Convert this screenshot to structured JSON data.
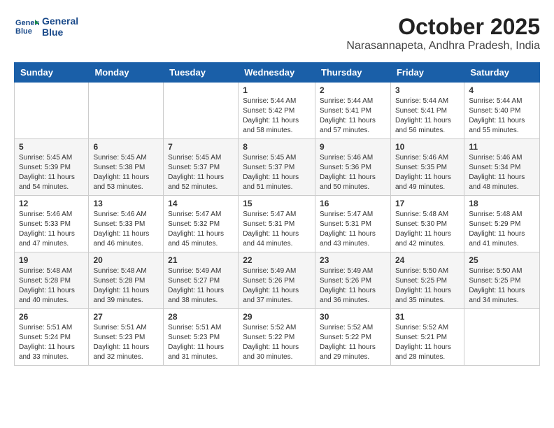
{
  "header": {
    "logo_line1": "General",
    "logo_line2": "Blue",
    "month_title": "October 2025",
    "location": "Narasannapeta, Andhra Pradesh, India"
  },
  "columns": [
    "Sunday",
    "Monday",
    "Tuesday",
    "Wednesday",
    "Thursday",
    "Friday",
    "Saturday"
  ],
  "weeks": [
    [
      {
        "day": "",
        "info": ""
      },
      {
        "day": "",
        "info": ""
      },
      {
        "day": "",
        "info": ""
      },
      {
        "day": "1",
        "info": "Sunrise: 5:44 AM\nSunset: 5:42 PM\nDaylight: 11 hours\nand 58 minutes."
      },
      {
        "day": "2",
        "info": "Sunrise: 5:44 AM\nSunset: 5:41 PM\nDaylight: 11 hours\nand 57 minutes."
      },
      {
        "day": "3",
        "info": "Sunrise: 5:44 AM\nSunset: 5:41 PM\nDaylight: 11 hours\nand 56 minutes."
      },
      {
        "day": "4",
        "info": "Sunrise: 5:44 AM\nSunset: 5:40 PM\nDaylight: 11 hours\nand 55 minutes."
      }
    ],
    [
      {
        "day": "5",
        "info": "Sunrise: 5:45 AM\nSunset: 5:39 PM\nDaylight: 11 hours\nand 54 minutes."
      },
      {
        "day": "6",
        "info": "Sunrise: 5:45 AM\nSunset: 5:38 PM\nDaylight: 11 hours\nand 53 minutes."
      },
      {
        "day": "7",
        "info": "Sunrise: 5:45 AM\nSunset: 5:37 PM\nDaylight: 11 hours\nand 52 minutes."
      },
      {
        "day": "8",
        "info": "Sunrise: 5:45 AM\nSunset: 5:37 PM\nDaylight: 11 hours\nand 51 minutes."
      },
      {
        "day": "9",
        "info": "Sunrise: 5:46 AM\nSunset: 5:36 PM\nDaylight: 11 hours\nand 50 minutes."
      },
      {
        "day": "10",
        "info": "Sunrise: 5:46 AM\nSunset: 5:35 PM\nDaylight: 11 hours\nand 49 minutes."
      },
      {
        "day": "11",
        "info": "Sunrise: 5:46 AM\nSunset: 5:34 PM\nDaylight: 11 hours\nand 48 minutes."
      }
    ],
    [
      {
        "day": "12",
        "info": "Sunrise: 5:46 AM\nSunset: 5:33 PM\nDaylight: 11 hours\nand 47 minutes."
      },
      {
        "day": "13",
        "info": "Sunrise: 5:46 AM\nSunset: 5:33 PM\nDaylight: 11 hours\nand 46 minutes."
      },
      {
        "day": "14",
        "info": "Sunrise: 5:47 AM\nSunset: 5:32 PM\nDaylight: 11 hours\nand 45 minutes."
      },
      {
        "day": "15",
        "info": "Sunrise: 5:47 AM\nSunset: 5:31 PM\nDaylight: 11 hours\nand 44 minutes."
      },
      {
        "day": "16",
        "info": "Sunrise: 5:47 AM\nSunset: 5:31 PM\nDaylight: 11 hours\nand 43 minutes."
      },
      {
        "day": "17",
        "info": "Sunrise: 5:48 AM\nSunset: 5:30 PM\nDaylight: 11 hours\nand 42 minutes."
      },
      {
        "day": "18",
        "info": "Sunrise: 5:48 AM\nSunset: 5:29 PM\nDaylight: 11 hours\nand 41 minutes."
      }
    ],
    [
      {
        "day": "19",
        "info": "Sunrise: 5:48 AM\nSunset: 5:28 PM\nDaylight: 11 hours\nand 40 minutes."
      },
      {
        "day": "20",
        "info": "Sunrise: 5:48 AM\nSunset: 5:28 PM\nDaylight: 11 hours\nand 39 minutes."
      },
      {
        "day": "21",
        "info": "Sunrise: 5:49 AM\nSunset: 5:27 PM\nDaylight: 11 hours\nand 38 minutes."
      },
      {
        "day": "22",
        "info": "Sunrise: 5:49 AM\nSunset: 5:26 PM\nDaylight: 11 hours\nand 37 minutes."
      },
      {
        "day": "23",
        "info": "Sunrise: 5:49 AM\nSunset: 5:26 PM\nDaylight: 11 hours\nand 36 minutes."
      },
      {
        "day": "24",
        "info": "Sunrise: 5:50 AM\nSunset: 5:25 PM\nDaylight: 11 hours\nand 35 minutes."
      },
      {
        "day": "25",
        "info": "Sunrise: 5:50 AM\nSunset: 5:25 PM\nDaylight: 11 hours\nand 34 minutes."
      }
    ],
    [
      {
        "day": "26",
        "info": "Sunrise: 5:51 AM\nSunset: 5:24 PM\nDaylight: 11 hours\nand 33 minutes."
      },
      {
        "day": "27",
        "info": "Sunrise: 5:51 AM\nSunset: 5:23 PM\nDaylight: 11 hours\nand 32 minutes."
      },
      {
        "day": "28",
        "info": "Sunrise: 5:51 AM\nSunset: 5:23 PM\nDaylight: 11 hours\nand 31 minutes."
      },
      {
        "day": "29",
        "info": "Sunrise: 5:52 AM\nSunset: 5:22 PM\nDaylight: 11 hours\nand 30 minutes."
      },
      {
        "day": "30",
        "info": "Sunrise: 5:52 AM\nSunset: 5:22 PM\nDaylight: 11 hours\nand 29 minutes."
      },
      {
        "day": "31",
        "info": "Sunrise: 5:52 AM\nSunset: 5:21 PM\nDaylight: 11 hours\nand 28 minutes."
      },
      {
        "day": "",
        "info": ""
      }
    ]
  ]
}
